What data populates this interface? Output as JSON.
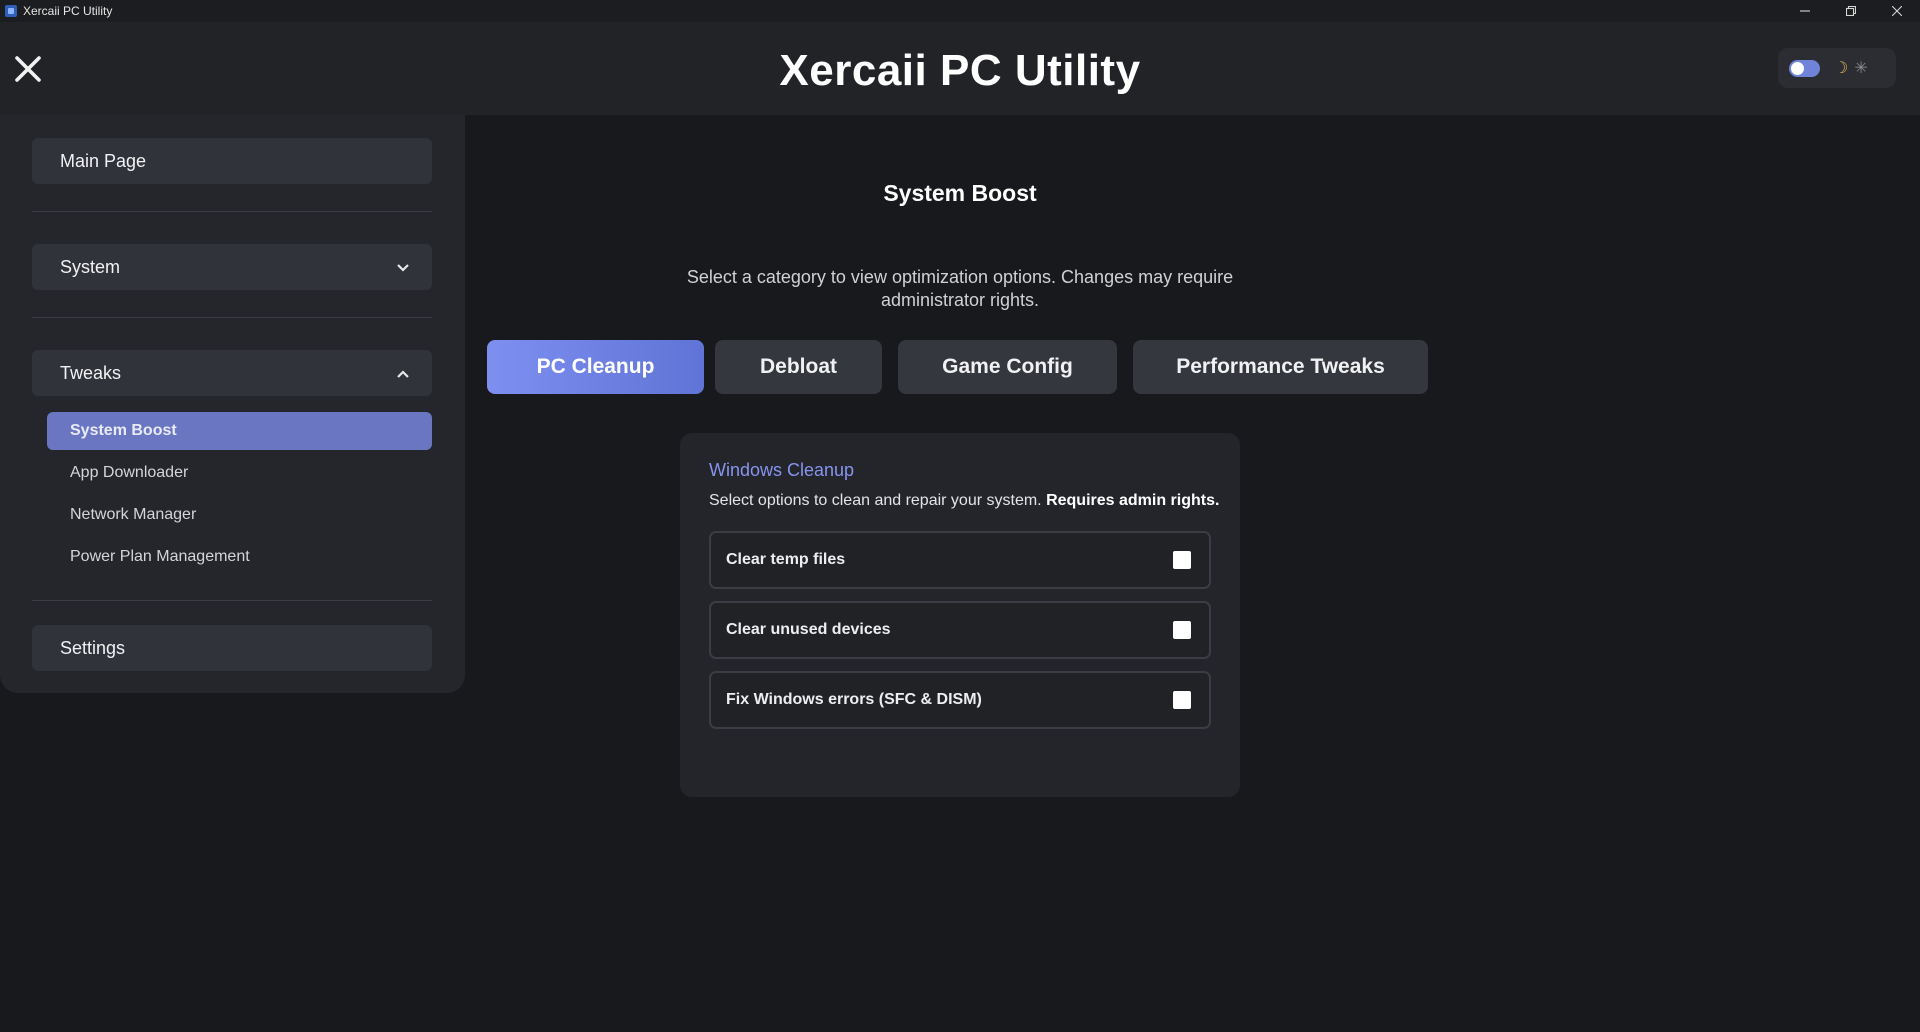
{
  "window": {
    "title": "Xercaii PC Utility",
    "controls": [
      "minimize",
      "restore",
      "close"
    ]
  },
  "header": {
    "app_title": "Xercaii PC Utility",
    "theme": {
      "dark_mode_on": true,
      "moon_icon": "☽",
      "sun_icon": "✳"
    }
  },
  "sidebar": {
    "main_page": "Main Page",
    "system": "System",
    "tweaks": "Tweaks",
    "tweaks_items": [
      {
        "label": "System Boost",
        "active": true
      },
      {
        "label": "App Downloader",
        "active": false
      },
      {
        "label": "Network Manager",
        "active": false
      },
      {
        "label": "Power Plan Management",
        "active": false
      }
    ],
    "settings": "Settings"
  },
  "main": {
    "title": "System Boost",
    "description": "Select a category to view optimization options. Changes may require administrator rights.",
    "tabs": [
      {
        "label": "PC Cleanup",
        "active": true
      },
      {
        "label": "Debloat",
        "active": false
      },
      {
        "label": "Game Config",
        "active": false
      },
      {
        "label": "Performance Tweaks",
        "active": false
      }
    ],
    "card": {
      "title": "Windows Cleanup",
      "description_plain": "Select options to clean and repair your system.",
      "description_bold": "Requires admin rights.",
      "options": [
        {
          "label": "Clear temp files",
          "checked": false
        },
        {
          "label": "Clear unused devices",
          "checked": false
        },
        {
          "label": "Fix Windows errors (SFC & DISM)",
          "checked": false
        }
      ]
    }
  },
  "colors": {
    "accent": "#6b76c2",
    "tab_active_start": "#7e8ff0",
    "tab_active_end": "#5f74d6",
    "card_title": "#8694ee",
    "background": "#18191c"
  }
}
